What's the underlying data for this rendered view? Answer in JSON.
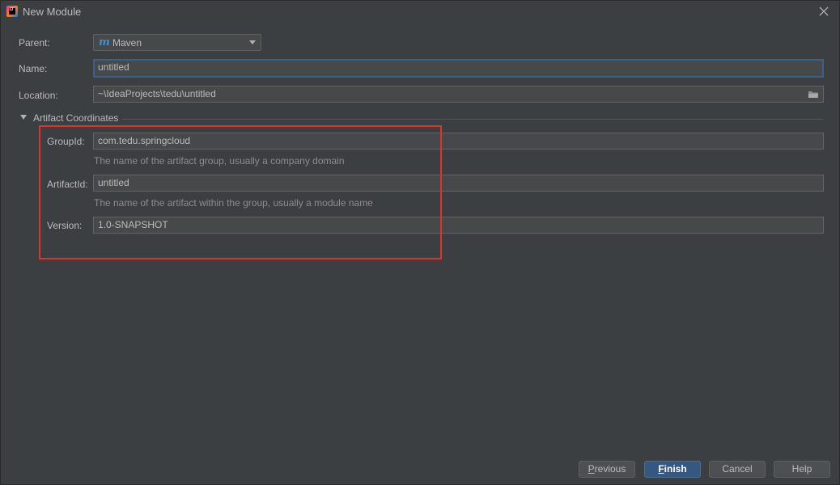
{
  "window": {
    "title": "New Module"
  },
  "form": {
    "parent": {
      "label": "Parent:",
      "value": "Maven",
      "icon": "maven-icon"
    },
    "name": {
      "label": "Name:",
      "value": "untitled"
    },
    "location": {
      "label": "Location:",
      "value": "~\\IdeaProjects\\tedu\\untitled",
      "icon": "folder-icon"
    }
  },
  "artifact": {
    "section_title": "Artifact Coordinates",
    "group_id": {
      "label": "GroupId:",
      "value": "com.tedu.springcloud",
      "hint": "The name of the artifact group, usually a company domain"
    },
    "artifact_id": {
      "label": "ArtifactId:",
      "value": "untitled",
      "hint": "The name of the artifact within the group, usually a module name"
    },
    "version": {
      "label": "Version:",
      "value": "1.0-SNAPSHOT"
    }
  },
  "buttons": {
    "previous": {
      "mnemonic": "P",
      "rest": "revious"
    },
    "finish": {
      "mnemonic": "F",
      "rest": "inish"
    },
    "cancel": "Cancel",
    "help": "Help"
  },
  "colors": {
    "background": "#3c3f41",
    "field": "#45494a",
    "focus_border": "#3d6185",
    "default_button": "#365880",
    "highlight_box": "#e3302a"
  }
}
